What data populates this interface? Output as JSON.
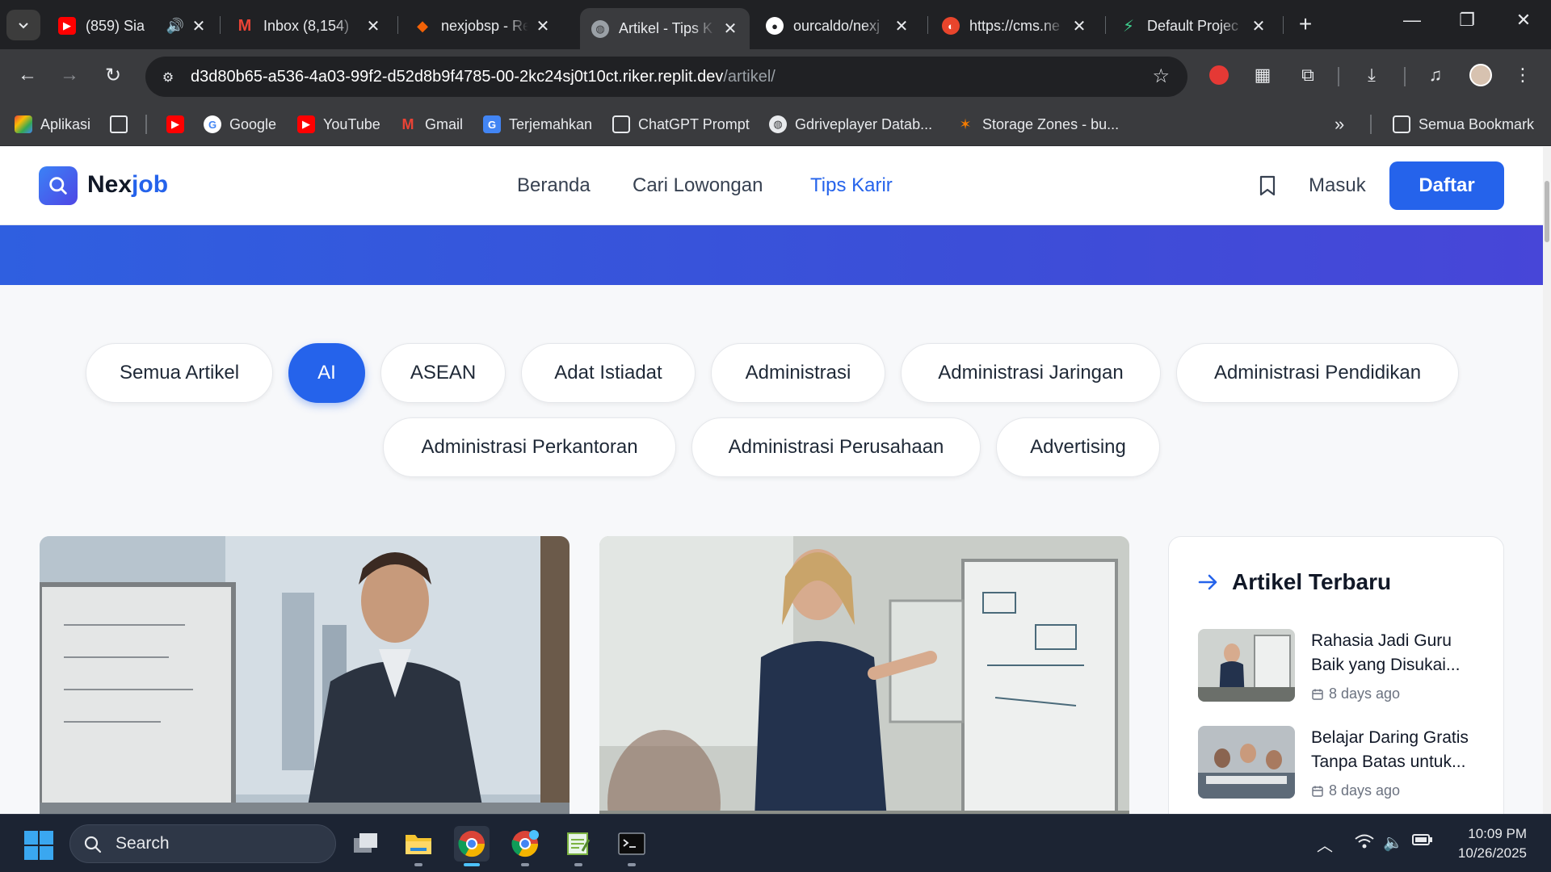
{
  "browser": {
    "tabs": [
      {
        "title": "(859) Sia",
        "icon": "youtube-icon",
        "color": "#ff0000"
      },
      {
        "title": "Inbox (8,154)",
        "icon": "gmail-icon",
        "color": "#ea4335"
      },
      {
        "title": "nexjobsp - Re",
        "icon": "replit-icon",
        "color": "#f26207"
      },
      {
        "title": "Artikel - Tips K",
        "icon": "globe-icon",
        "color": "#9aa0a6"
      },
      {
        "title": "ourcaldo/nexj",
        "icon": "github-icon",
        "color": "#ffffff"
      },
      {
        "title": "https://cms.ne",
        "icon": "site-icon",
        "color": "#e8452c"
      },
      {
        "title": "Default Projec",
        "icon": "bolt-icon",
        "color": "#3ecf8e"
      }
    ],
    "url_host": "d3d80b65-a536-4a03-99f2-d52d8b9f4785-00-2kc24sj0t10ct.riker.replit.dev",
    "url_path": "/artikel/",
    "bookmarks": [
      {
        "label": "Aplikasi"
      },
      {
        "label": ""
      },
      {
        "label": ""
      },
      {
        "label": "Google"
      },
      {
        "label": "YouTube"
      },
      {
        "label": "Gmail"
      },
      {
        "label": "Terjemahkan"
      },
      {
        "label": "ChatGPT Prompt"
      },
      {
        "label": "Gdriveplayer Datab..."
      },
      {
        "label": "Storage Zones - bu..."
      }
    ],
    "more_bookmarks": "»",
    "all_bookmarks": "Semua Bookmark"
  },
  "site": {
    "logo_prefix": "Nex",
    "logo_suffix": "job",
    "nav": [
      {
        "label": "Beranda",
        "active": false
      },
      {
        "label": "Cari Lowongan",
        "active": false
      },
      {
        "label": "Tips Karir",
        "active": true
      }
    ],
    "login": "Masuk",
    "signup": "Daftar",
    "accent": "#2563eb"
  },
  "categories": [
    {
      "label": "Semua Artikel",
      "active": false
    },
    {
      "label": "AI",
      "active": true
    },
    {
      "label": "ASEAN",
      "active": false
    },
    {
      "label": "Adat Istiadat",
      "active": false
    },
    {
      "label": "Administrasi",
      "active": false
    },
    {
      "label": "Administrasi Jaringan",
      "active": false
    },
    {
      "label": "Administrasi Pendidikan",
      "active": false
    },
    {
      "label": "Administrasi Perkantoran",
      "active": false
    },
    {
      "label": "Administrasi Perusahaan",
      "active": false
    },
    {
      "label": "Advertising",
      "active": false
    }
  ],
  "sidebar": {
    "title": "Artikel Terbaru",
    "items": [
      {
        "title": "Rahasia Jadi Guru Baik yang Disukai...",
        "date": "8 days ago"
      },
      {
        "title": "Belajar Daring Gratis Tanpa Batas untuk...",
        "date": "8 days ago"
      }
    ]
  },
  "taskbar": {
    "search_placeholder": "Search",
    "time": "10:09 PM",
    "date": "10/26/2025"
  }
}
